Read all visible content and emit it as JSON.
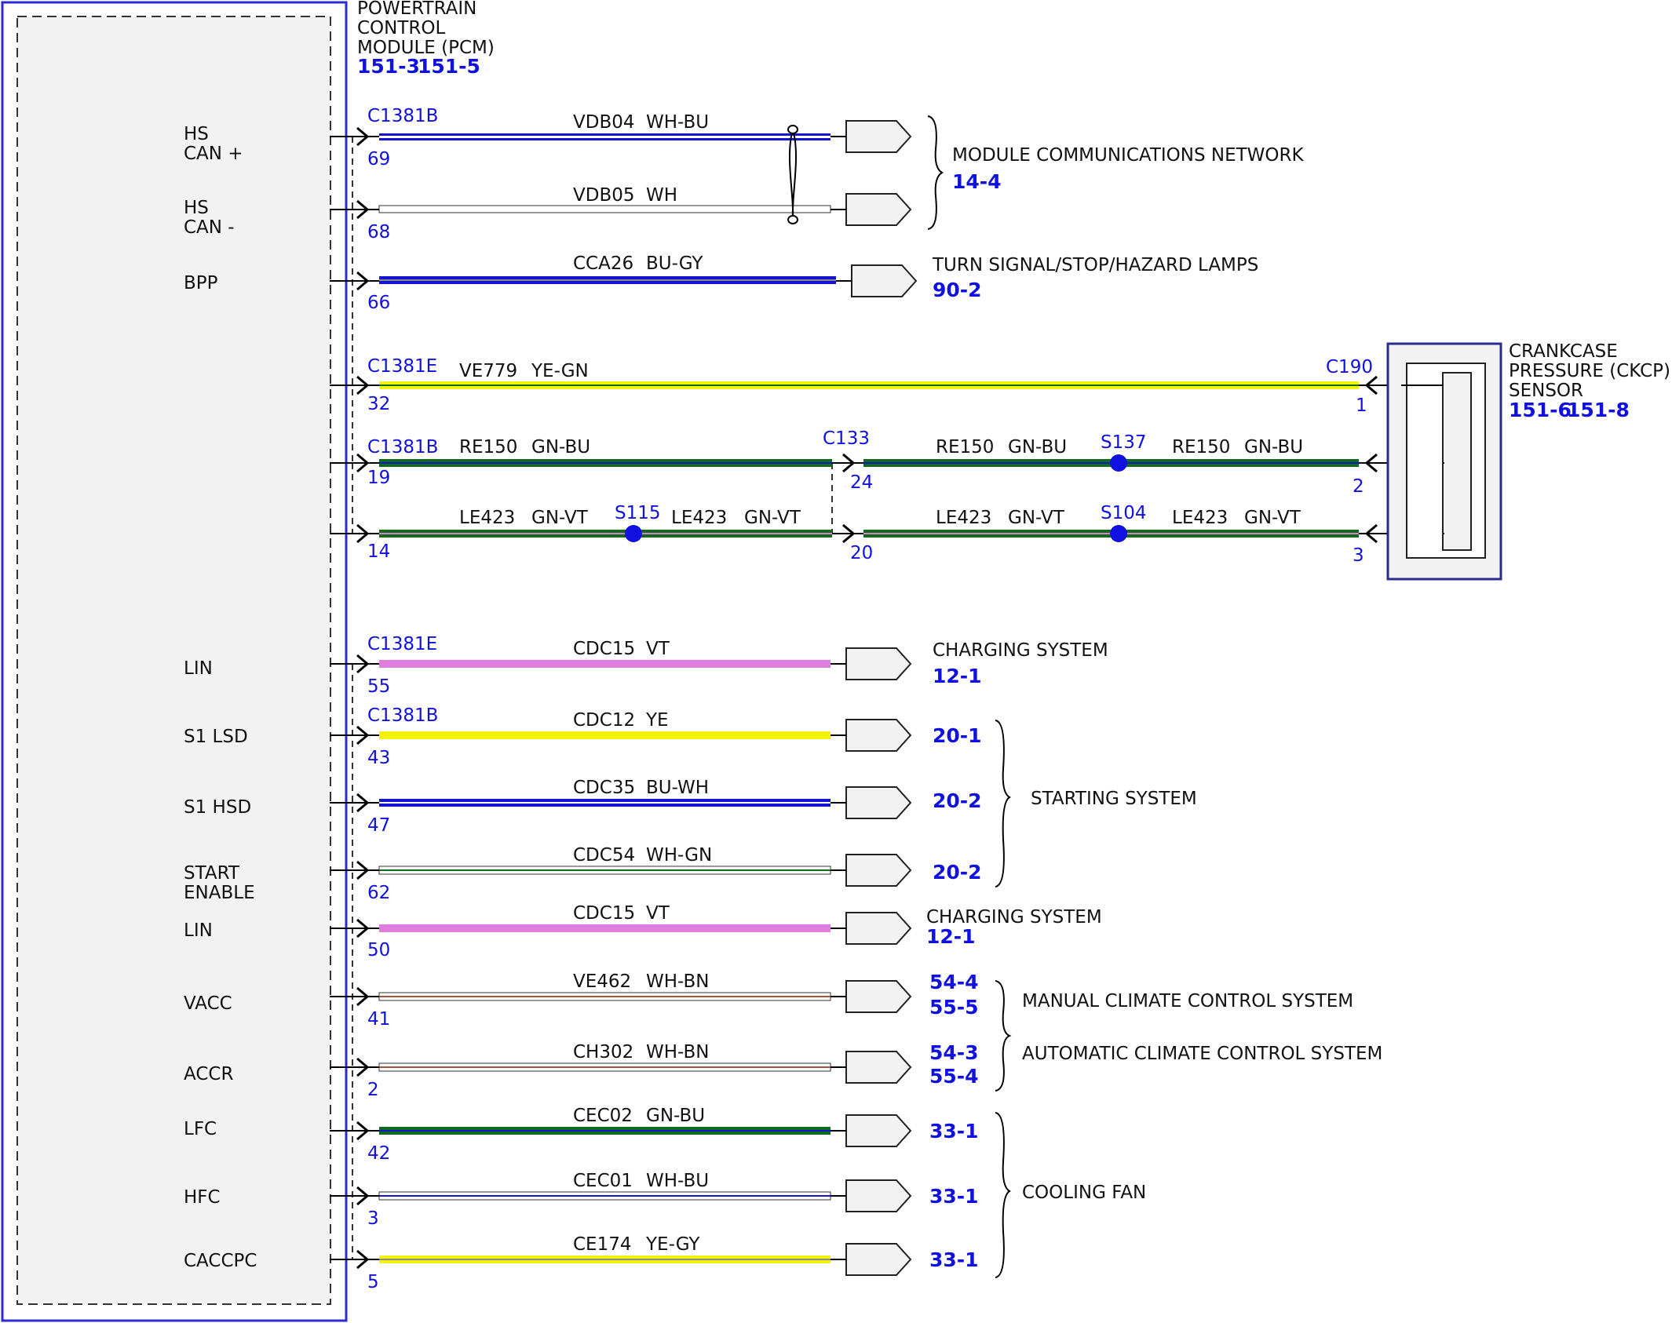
{
  "colors": {
    "accent_blue": "#1010e0",
    "module_border": "#2b2bd6",
    "module_fill": "#f2f2f2",
    "wire_WH": "#ffffff",
    "wire_BU": "#1414d2",
    "wire_GN": "#0d6b1a",
    "wire_YE": "#f2f20a",
    "wire_VT": "#e07ee0",
    "wire_BN": "#a5553a",
    "wire_GY": "#8c8c8c"
  },
  "pcm": {
    "title_lines": [
      "POWERTRAIN",
      "CONTROL",
      "MODULE (PCM)"
    ],
    "refs": [
      "151-3",
      "151-5"
    ]
  },
  "pins": [
    {
      "lines": [
        "HS",
        "CAN +"
      ]
    },
    {
      "lines": [
        "HS",
        "CAN -"
      ]
    },
    {
      "lines": [
        "BPP"
      ]
    },
    {
      "lines": [
        "LIN"
      ]
    },
    {
      "lines": [
        "S1 LSD"
      ]
    },
    {
      "lines": [
        "S1 HSD"
      ]
    },
    {
      "lines": [
        "START",
        "ENABLE"
      ]
    },
    {
      "lines": [
        "LIN"
      ]
    },
    {
      "lines": [
        "VACC"
      ]
    },
    {
      "lines": [
        "ACCR"
      ]
    },
    {
      "lines": [
        "LFC"
      ]
    },
    {
      "lines": [
        "HFC"
      ]
    },
    {
      "lines": [
        "CACCPC"
      ]
    }
  ],
  "connectors": [
    "C1381B",
    "C1381B",
    "C1381E",
    "C1381B",
    "C1381E",
    "C1381B",
    "C133",
    "C190"
  ],
  "wires": [
    {
      "circuit": "VDB04",
      "color": "WH-BU",
      "pin": "69"
    },
    {
      "circuit": "VDB05",
      "color": "WH",
      "pin": "68"
    },
    {
      "circuit": "CCA26",
      "color": "BU-GY",
      "pin": "66"
    },
    {
      "circuit": "VE779",
      "color": "YE-GN",
      "pin": "32",
      "far_pin": "1"
    },
    {
      "circuit": "RE150",
      "color": "GN-BU",
      "pin": "19",
      "mid_pin": "24",
      "far_pin": "2"
    },
    {
      "circuit": "LE423",
      "color": "GN-VT",
      "pin": "14",
      "mid_pin": "20",
      "far_pin": "3"
    },
    {
      "circuit": "CDC15",
      "color": "VT",
      "pin": "55"
    },
    {
      "circuit": "CDC12",
      "color": "YE",
      "pin": "43"
    },
    {
      "circuit": "CDC35",
      "color": "BU-WH",
      "pin": "47"
    },
    {
      "circuit": "CDC54",
      "color": "WH-GN",
      "pin": "62"
    },
    {
      "circuit": "CDC15",
      "color": "VT",
      "pin": "50"
    },
    {
      "circuit": "VE462",
      "color": "WH-BN",
      "pin": "41"
    },
    {
      "circuit": "CH302",
      "color": "WH-BN",
      "pin": "2"
    },
    {
      "circuit": "CEC02",
      "color": "GN-BU",
      "pin": "42"
    },
    {
      "circuit": "CEC01",
      "color": "WH-BU",
      "pin": "3"
    },
    {
      "circuit": "CE174",
      "color": "YE-GY",
      "pin": "5"
    }
  ],
  "splices": [
    "S115",
    "S137",
    "S104"
  ],
  "destinations": [
    {
      "name": "MODULE COMMUNICATIONS NETWORK",
      "ref": "14-4"
    },
    {
      "name": "TURN SIGNAL/STOP/HAZARD LAMPS",
      "ref": "90-2"
    },
    {
      "name": "CHARGING SYSTEM",
      "ref": "12-1"
    },
    {
      "name": "STARTING SYSTEM",
      "refs": [
        "20-1",
        "20-2",
        "20-2"
      ]
    },
    {
      "name": "CHARGING SYSTEM",
      "ref": "12-1"
    },
    {
      "name": "MANUAL CLIMATE CONTROL SYSTEM",
      "refs": [
        "54-4",
        "55-5"
      ]
    },
    {
      "name": "AUTOMATIC CLIMATE CONTROL SYSTEM",
      "refs": [
        "54-3",
        "55-4"
      ]
    },
    {
      "name": "COOLING FAN",
      "refs": [
        "33-1",
        "33-1",
        "33-1"
      ]
    }
  ],
  "sensor": {
    "title_lines": [
      "CRANKCASE",
      "PRESSURE (CKCP)",
      "SENSOR"
    ],
    "refs": [
      "151-6",
      "151-8"
    ]
  }
}
